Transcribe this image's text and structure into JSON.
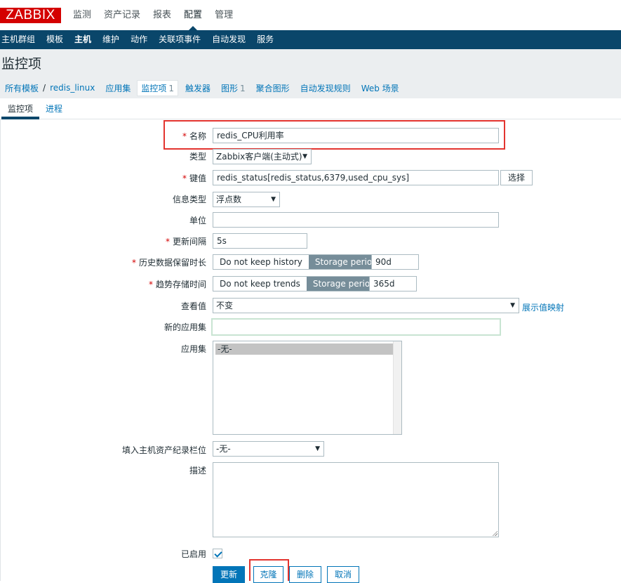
{
  "logo": "ZABBIX",
  "main_menu": [
    "监测",
    "资产记录",
    "报表",
    "配置",
    "管理"
  ],
  "sub_menu": [
    "主机群组",
    "模板",
    "主机",
    "维护",
    "动作",
    "关联项事件",
    "自动发现",
    "服务"
  ],
  "page_title": "监控项",
  "breadcrumb": {
    "all_templates": "所有模板",
    "separator": "/",
    "host": "redis_linux",
    "applications": "应用集",
    "items": "监控项",
    "items_count": "1",
    "triggers": "触发器",
    "graphs": "图形",
    "graphs_count": "1",
    "screens": "聚合图形",
    "discovery": "自动发现规则",
    "web": "Web 场景"
  },
  "tabs": [
    "监控项",
    "进程"
  ],
  "form": {
    "name_label": "名称",
    "name_value": "redis_CPU利用率",
    "type_label": "类型",
    "type_value": "Zabbix客户端(主动式)",
    "key_label": "键值",
    "key_value": "redis_status[redis_status,6379,used_cpu_sys]",
    "key_select_button": "选择",
    "info_type_label": "信息类型",
    "info_type_value": "浮点数",
    "units_label": "单位",
    "units_value": "",
    "interval_label": "更新间隔",
    "interval_value": "5s",
    "history_label": "历史数据保留时长",
    "history_off": "Do not keep history",
    "history_on": "Storage period",
    "history_value": "90d",
    "trends_label": "趋势存储时间",
    "trends_off": "Do not keep trends",
    "trends_on": "Storage period",
    "trends_value": "365d",
    "valuemap_label": "查看值",
    "valuemap_value": "不变",
    "valuemap_link": "展示值映射",
    "new_app_label": "新的应用集",
    "new_app_value": "",
    "apps_label": "应用集",
    "apps_option": "-无-",
    "inventory_label": "填入主机资产纪录栏位",
    "inventory_value": "-无-",
    "desc_label": "描述",
    "enabled_label": "已启用"
  },
  "buttons": {
    "update": "更新",
    "clone": "克隆",
    "delete": "删除",
    "cancel": "取消"
  },
  "colors": {
    "brand": "#d40000",
    "nav": "#0a466a",
    "link": "#0275b8",
    "highlight": "#e3342f"
  }
}
